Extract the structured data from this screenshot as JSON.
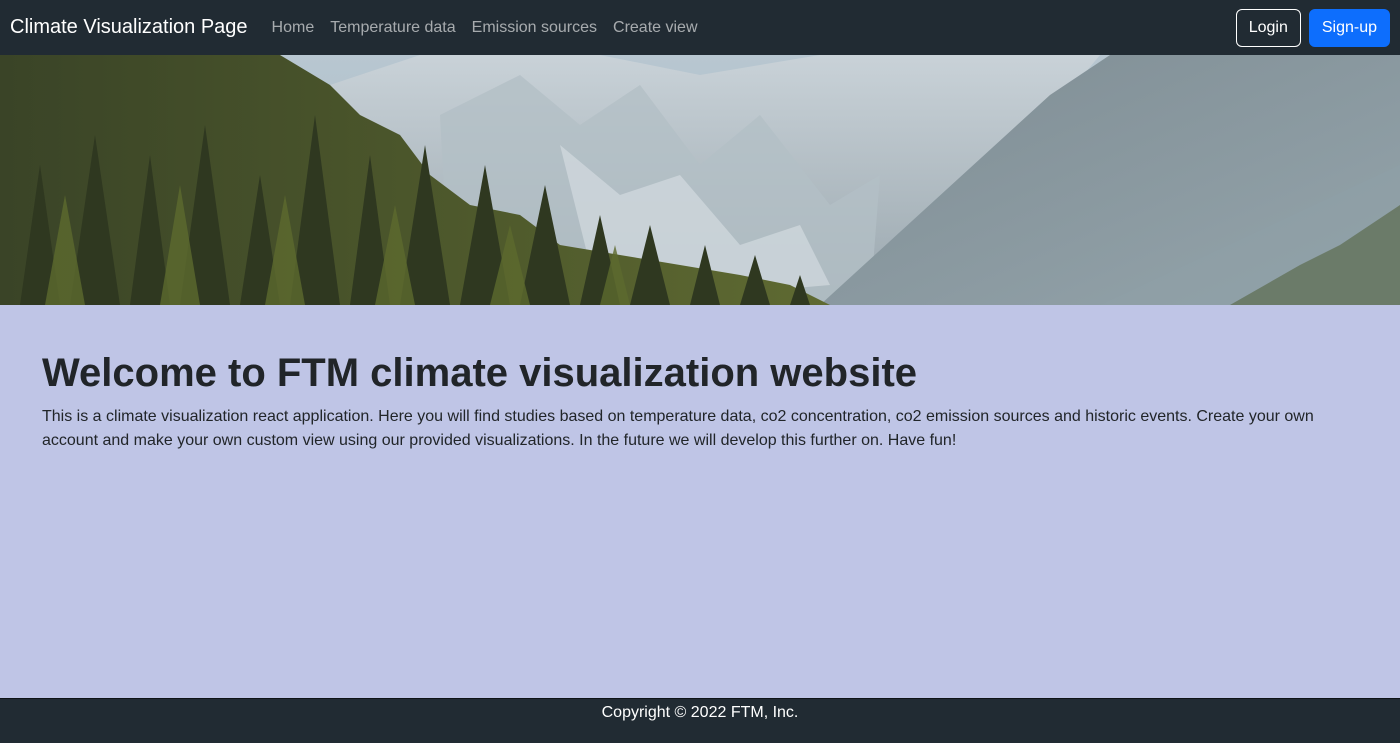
{
  "navbar": {
    "brand": "Climate Visualization Page",
    "links": [
      "Home",
      "Temperature data",
      "Emission sources",
      "Create view"
    ],
    "login_label": "Login",
    "signup_label": "Sign-up"
  },
  "hero": {
    "image": "mountain-forest-landscape"
  },
  "main": {
    "title": "Welcome to FTM climate visualization website",
    "description": "This is a climate visualization react application. Here you will find studies based on temperature data, co2 concentration, co2 emission sources and historic events. Create your own account and make your own custom view using our provided visualizations. In the future we will develop this further on. Have fun!"
  },
  "footer": {
    "copyright": "Copyright © 2022 FTM, Inc."
  },
  "colors": {
    "navbar_bg": "#212b33",
    "content_bg": "#bfc5e6",
    "primary": "#0d6efd",
    "text": "#212529"
  }
}
